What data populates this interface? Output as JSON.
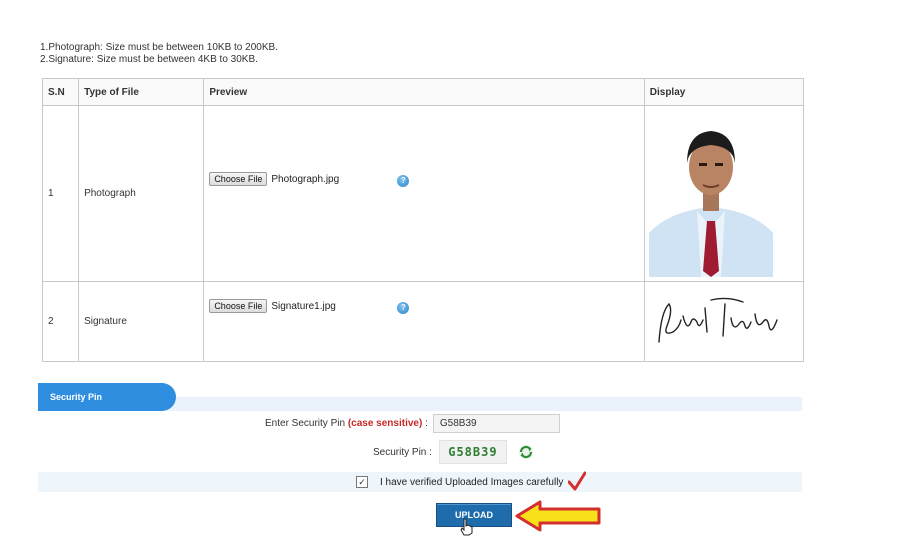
{
  "notes": [
    "1.Photograph: Size must be between 10KB to 200KB.",
    "2.Signature: Size must be between 4KB to 30KB."
  ],
  "table": {
    "headers": [
      "S.N",
      "Type of File",
      "Preview",
      "Display"
    ],
    "rows": [
      {
        "sn": "1",
        "type": "Photograph",
        "button": "Choose File",
        "file": "Photograph.jpg"
      },
      {
        "sn": "2",
        "type": "Signature",
        "button": "Choose File",
        "file": "Signature1.jpg"
      }
    ]
  },
  "security": {
    "tab_label": "Security Pin",
    "enter_label": "Enter Security Pin",
    "case_note": "(case sensitive)",
    "colon": ":",
    "input_value": "G58B39",
    "pin_label": "Security Pin :",
    "captcha_text": "G58B39"
  },
  "verify_label": "I have verified Uploaded Images carefully",
  "upload_label": "UPLOAD",
  "icons": {
    "help": "help-circle-icon",
    "refresh": "refresh-icon",
    "check": "checkmark-icon",
    "pointer": "hand-pointer-icon",
    "arrow": "yellow-arrow-icon"
  },
  "colors": {
    "accent": "#2f8ee0",
    "upload": "#1f6cad",
    "case_sensitive": "#c62828",
    "captcha": "#2e7d32",
    "arrow_fill": "#f7e11b",
    "arrow_stroke": "#d32f2f"
  }
}
